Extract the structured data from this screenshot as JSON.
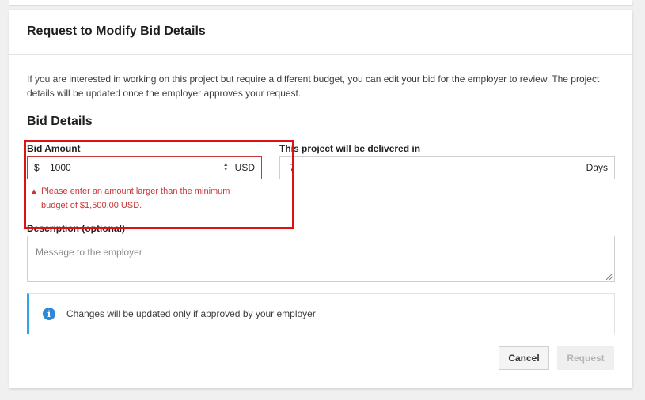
{
  "modal": {
    "title": "Request to Modify Bid Details",
    "intro": "If you are interested in working on this project but require a different budget, you can edit your bid for the employer to review. The project details will be updated once the employer approves your request.",
    "section_title": "Bid Details"
  },
  "bid_amount": {
    "label": "Bid Amount",
    "prefix": "$",
    "value": "1000",
    "currency": "USD",
    "error_message": "Please enter an amount larger than the minimum budget of $1,500.00 USD."
  },
  "delivery": {
    "label": "This project will be delivered in",
    "value": "7",
    "unit": "Days"
  },
  "description": {
    "label": "Description (optional)",
    "placeholder": "Message to the employer"
  },
  "info": {
    "text": "Changes will be updated only if approved by your employer"
  },
  "buttons": {
    "cancel": "Cancel",
    "request": "Request"
  },
  "colors": {
    "error": "#c73737",
    "info_accent": "#2fa4e7",
    "highlight": "#dd1111"
  }
}
